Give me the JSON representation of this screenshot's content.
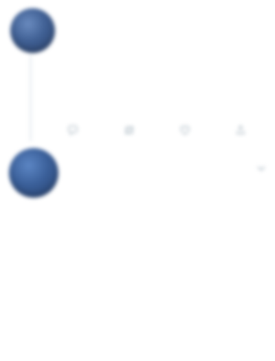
{
  "reply": {
    "name": "",
    "handle": "",
    "text": "",
    "actions": {
      "reply_count": "",
      "retweet_count": "",
      "like_count": ""
    }
  },
  "tweet": {
    "name": "",
    "handle": "",
    "paragraph_1": "",
    "paragraph_2": "",
    "link_text": ""
  },
  "icons": [
    "avatar",
    "reply-icon",
    "retweet-icon",
    "like-icon",
    "share-icon",
    "chevron-down-icon"
  ],
  "colors": {
    "text": "#14171a",
    "muted": "#657786",
    "link": "#1da1f2",
    "divider": "#e6ecf0"
  }
}
